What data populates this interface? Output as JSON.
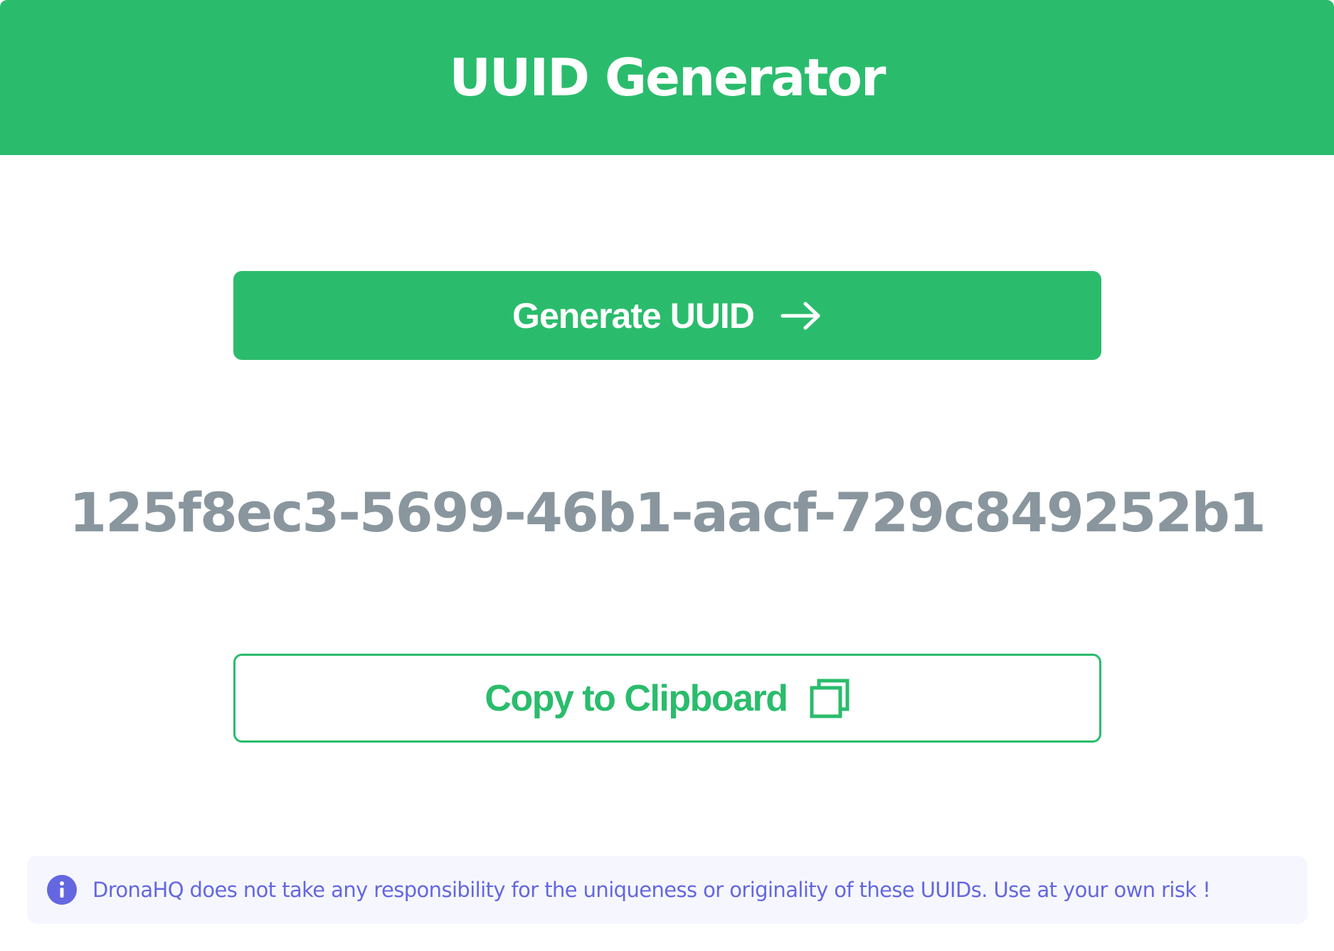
{
  "header": {
    "title": "UUID Generator"
  },
  "generate": {
    "label": "Generate UUID",
    "icon": "arrow-right-icon"
  },
  "output": {
    "uuid": "125f8ec3-5699-46b1-aacf-729c849252b1"
  },
  "copy": {
    "label": "Copy to Clipboard",
    "icon": "copy-icon"
  },
  "disclaimer": {
    "icon": "info-icon",
    "text": "DronaHQ does not take any responsibility for the uniqueness or originality of these UUIDs. Use at your own risk !"
  },
  "colors": {
    "brand_green": "#2abc6c",
    "uuid_gray": "#8a969e",
    "info_purple": "#6467e0",
    "disclaimer_bg": "#f6f7fe"
  }
}
